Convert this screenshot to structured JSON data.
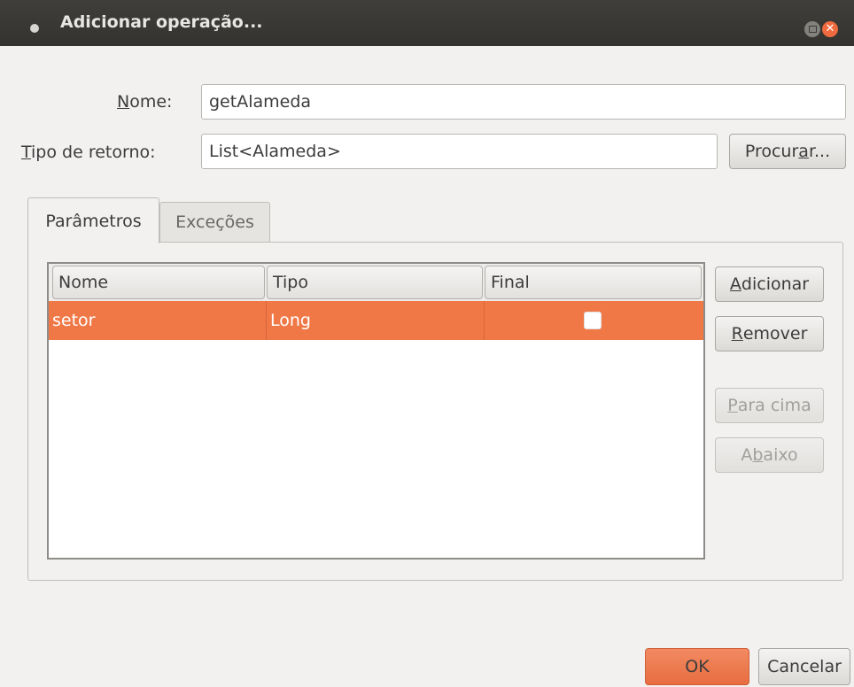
{
  "window": {
    "title": "Adicionar operação..."
  },
  "form": {
    "name_label_ul": "N",
    "name_label_rest": "ome:",
    "name_value": "getAlameda",
    "return_label_ul": "T",
    "return_label_rest": "ipo de retorno:",
    "return_value": "List<Alameda>",
    "browse_pre": "Procur",
    "browse_ul": "a",
    "browse_post": "r..."
  },
  "tabs": [
    {
      "label": "Parâmetros",
      "active": true
    },
    {
      "label": "Exceções",
      "active": false
    }
  ],
  "table": {
    "columns": [
      "Nome",
      "Tipo",
      "Final"
    ],
    "rows": [
      {
        "nome": "setor",
        "tipo": "Long",
        "final": false,
        "selected": true
      }
    ]
  },
  "side_buttons": {
    "add_ul": "A",
    "add_rest": "dicionar",
    "remove_ul": "R",
    "remove_rest": "emover",
    "up_ul": "P",
    "up_rest": "ara cima",
    "down_pre": "A",
    "down_ul": "b",
    "down_post": "aixo"
  },
  "footer": {
    "ok": "OK",
    "cancel": "Cancelar"
  },
  "colors": {
    "accent": "#f07846",
    "titlebar": "#3a3935",
    "background": "#f2f1f0"
  }
}
